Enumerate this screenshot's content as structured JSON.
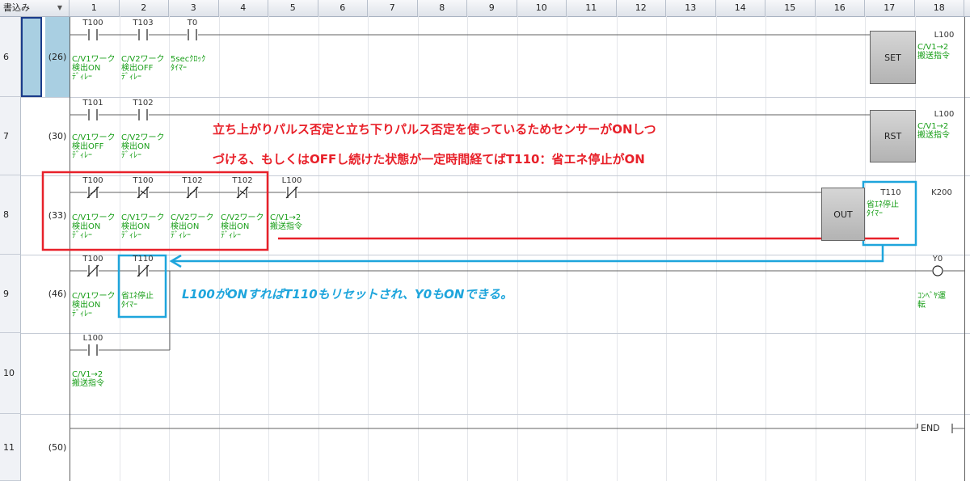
{
  "header": {
    "mode_label": "書込み",
    "columns": [
      "1",
      "2",
      "3",
      "4",
      "5",
      "6",
      "7",
      "8",
      "9",
      "10",
      "11",
      "12",
      "13",
      "14",
      "15",
      "16",
      "17",
      "18"
    ]
  },
  "rows": [
    {
      "num": "6",
      "step": "(26)"
    },
    {
      "num": "7",
      "step": "(30)"
    },
    {
      "num": "8",
      "step": "(33)"
    },
    {
      "num": "9",
      "step": "(46)"
    },
    {
      "num": "10",
      "step": ""
    },
    {
      "num": "11",
      "step": "(50)"
    }
  ],
  "ladder": {
    "r6": {
      "contacts": [
        "T100",
        "T103",
        "T0"
      ],
      "comments": [
        "C/V1ワーク\n検出ON\nﾃﾞｨﾚｰ",
        "C/V2ワーク\n検出OFF\nﾃﾞｨﾚｰ",
        "5secｸﾛｯｸ\nﾀｲﾏｰ"
      ],
      "instr": "SET",
      "out_device": "L100",
      "out_comment": "C/V1→2\n搬送指令"
    },
    "r7": {
      "contacts": [
        "T101",
        "T102"
      ],
      "comments": [
        "C/V1ワーク\n検出OFF\nﾃﾞｨﾚｰ",
        "C/V2ワーク\n検出ON\nﾃﾞｨﾚｰ"
      ],
      "instr": "RST",
      "out_device": "L100",
      "out_comment": "C/V1→2\n搬送指令"
    },
    "r8": {
      "contacts": [
        "T100",
        "T100",
        "T102",
        "T102",
        "L100"
      ],
      "comments": [
        "C/V1ワーク\n検出ON\nﾃﾞｨﾚｰ",
        "C/V1ワーク\n検出ON\nﾃﾞｨﾚｰ",
        "C/V2ワーク\n検出ON\nﾃﾞｨﾚｰ",
        "C/V2ワーク\n検出ON\nﾃﾞｨﾚｰ",
        "C/V1→2\n搬送指令"
      ],
      "instr": "OUT",
      "out_device": "T110",
      "out_comment": "省ｴﾈ停止\nﾀｲﾏｰ",
      "setting": "K200"
    },
    "r9": {
      "contacts": [
        "T100",
        "T110"
      ],
      "comments": [
        "C/V1ワーク\n検出ON\nﾃﾞｨﾚｰ",
        "省ｴﾈ停止\nﾀｲﾏｰ"
      ],
      "coil": "Y0",
      "coil_comment": "ｺﾝﾍﾞﾔ運\n転"
    },
    "r10": {
      "contacts": [
        "L100"
      ],
      "comments": [
        "C/V1→2\n搬送指令"
      ]
    },
    "r11": {
      "end": "END"
    }
  },
  "annotations": {
    "red_line1": "立ち上がりパルス否定と立ち下りパルス否定を使っているためセンサーがONしつ",
    "red_line2": "づける、もしくはOFFし続けた状態が一定時間経てばT110：省エネ停止がON",
    "blue_text": "L100がONすればT110もリセットされ、Y0もONできる。"
  },
  "colors": {
    "comment_green": "#179e17",
    "annotation_red": "#e8212a",
    "annotation_blue": "#1ea5dc",
    "selection_blue": "#a9cfe2"
  }
}
